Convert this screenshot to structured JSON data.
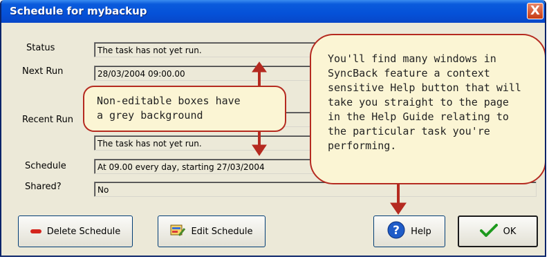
{
  "window": {
    "title": "Schedule for mybackup",
    "close_label": "X"
  },
  "fields": {
    "status_label": "Status",
    "status_value": "The task has not yet run.",
    "next_run_label": "Next Run",
    "next_run_value": "28/03/2004 09:00.00",
    "recent_run_label": "Recent Run",
    "recent_run_value": "The task has not yet run.",
    "schedule_label": "Schedule",
    "schedule_value": "At 09.00 every day, starting 27/03/2004",
    "shared_label": "Shared?",
    "shared_value": "No"
  },
  "buttons": {
    "delete_label": "Delete Schedule",
    "edit_label": "Edit Schedule",
    "help_label": "Help",
    "ok_label": "OK"
  },
  "callouts": {
    "left_lines": [
      "Non-editable boxes have",
      "a grey background"
    ],
    "right_lines": [
      "You'll find many windows in",
      "SyncBack feature a context",
      "sensitive Help button that will",
      "take you straight to the page",
      "in the Help Guide relating to",
      "the particular task you're",
      "performing."
    ]
  },
  "colors": {
    "annotation_red": "#b52a20",
    "title_blue": "#0551d8",
    "callout_fill": "#fbf5d4"
  },
  "icons": {
    "delete": "red-minus-icon",
    "edit": "edit-schedule-icon",
    "help": "help-question-icon",
    "ok": "green-checkmark-icon",
    "close": "close-x-icon"
  }
}
